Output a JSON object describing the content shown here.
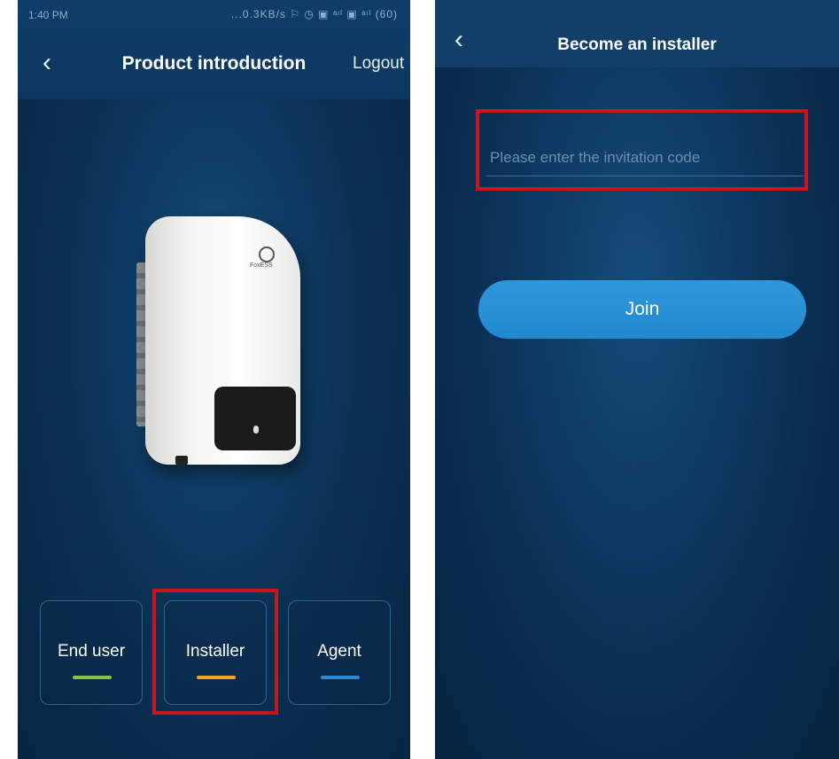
{
  "left_screen": {
    "status": {
      "time": "1:40 PM",
      "icons": "...0.3KB/s ⚐ ◷ ▣ ᵃᶥˡ ▣ ᵃᶥˡ (60)"
    },
    "header": {
      "back_icon": "‹",
      "title": "Product introduction",
      "logout_label": "Logout"
    },
    "device": {
      "logo_text": "FoxESS"
    },
    "roles": [
      {
        "label": "End user",
        "accent": "#8bc34a"
      },
      {
        "label": "Installer",
        "accent": "#f0a020"
      },
      {
        "label": "Agent",
        "accent": "#2a8ad8"
      }
    ],
    "highlight_color": "#c9151e"
  },
  "right_screen": {
    "header": {
      "back_icon": "‹",
      "title": "Become an installer"
    },
    "invitation_input": {
      "value": "",
      "placeholder": "Please enter the invitation code"
    },
    "join_label": "Join",
    "join_color": "#2a92d9"
  }
}
